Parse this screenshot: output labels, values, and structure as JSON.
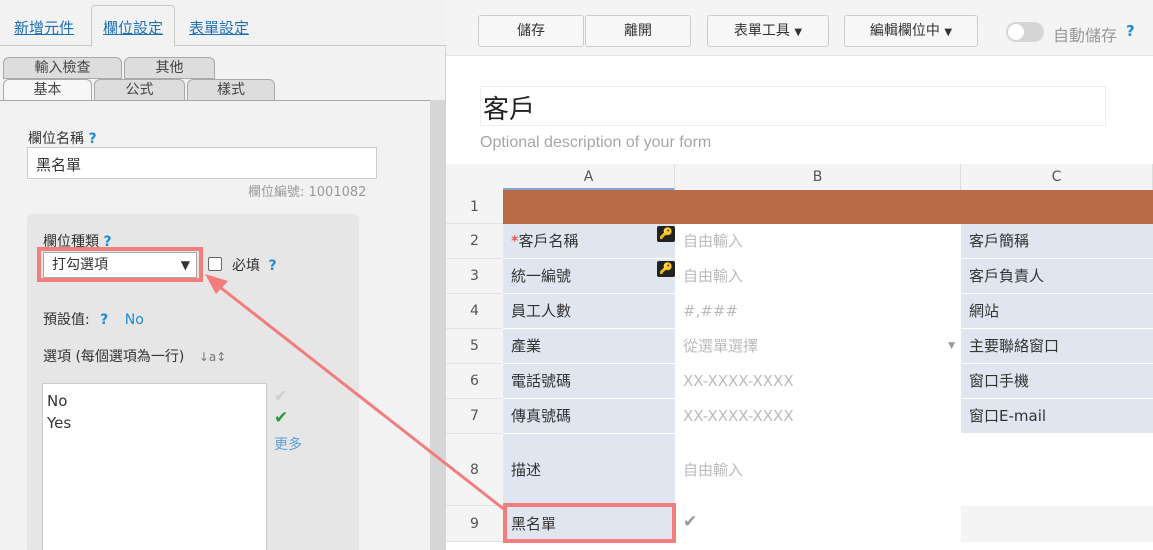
{
  "left": {
    "tabs": [
      "新增元件",
      "欄位設定",
      "表單設定"
    ],
    "subtabs_top": [
      "輸入檢查",
      "其他"
    ],
    "subtabs_bottom": [
      "基本",
      "公式",
      "樣式"
    ],
    "field_name_label": "欄位名稱",
    "field_name_value": "黑名單",
    "field_id": "欄位編號: 1001082",
    "field_type_label": "欄位種類",
    "field_type_value": "打勾選項",
    "required_label": "必填",
    "default_label": "預設值:",
    "default_value": "No",
    "options_label": "選項 (每個選項為一行)",
    "options_text": [
      "No",
      "Yes"
    ],
    "more_label": "更多",
    "help": "?"
  },
  "toolbar": {
    "save": "儲存",
    "leave": "離開",
    "form_tools": "表單工具",
    "edit_field": "編輯欄位中",
    "autosave": "自動儲存",
    "help": "?"
  },
  "form": {
    "title": "客戶",
    "description_placeholder": "Optional description of your form"
  },
  "grid": {
    "columns": [
      "A",
      "B",
      "C"
    ],
    "rows": [
      {
        "num": "1",
        "a": "",
        "b": "",
        "c": ""
      },
      {
        "num": "2",
        "a": "客戶名稱",
        "required": true,
        "b": "自由輸入",
        "c": "客戶簡稱"
      },
      {
        "num": "3",
        "a": "統一編號",
        "b": "自由輸入",
        "c": "客戶負責人"
      },
      {
        "num": "4",
        "a": "員工人數",
        "b": "#,###",
        "c": "網站"
      },
      {
        "num": "5",
        "a": "產業",
        "b": "從選單選擇",
        "c": "主要聯絡窗口"
      },
      {
        "num": "6",
        "a": "電話號碼",
        "b": "XX-XXXX-XXXX",
        "c": "窗口手機"
      },
      {
        "num": "7",
        "a": "傳真號碼",
        "b": "XX-XXXX-XXXX",
        "c": "窗口E-mail"
      },
      {
        "num": "8",
        "a": "描述",
        "b": "自由輸入",
        "c": ""
      },
      {
        "num": "9",
        "a": "黑名單",
        "b": "",
        "c": ""
      }
    ]
  },
  "colors": {
    "accent": "#1f6fb5",
    "header_row": "#b96a47",
    "label_cell": "#dfe6ef",
    "highlight": "#f17d7d"
  }
}
